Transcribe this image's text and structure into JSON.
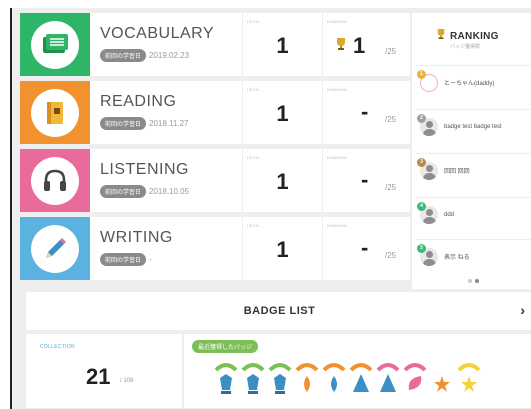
{
  "skills": [
    {
      "name": "VOCABULARY",
      "date_tag": "前回の学習日",
      "date": "2019.02.23",
      "level_label": "LEVEL",
      "level": "1",
      "ranking_label": "RANKING",
      "rank": "1",
      "rank_total": "/25",
      "color": "#2fb567"
    },
    {
      "name": "READING",
      "date_tag": "前回の学習日",
      "date": "2018.11.27",
      "level_label": "LEVEL",
      "level": "1",
      "ranking_label": "RANKING",
      "rank": "-",
      "rank_total": "/25",
      "color": "#f2922f"
    },
    {
      "name": "LISTENING",
      "date_tag": "前回の学習日",
      "date": "2018.10.05",
      "level_label": "LEVEL",
      "level": "1",
      "ranking_label": "RANKING",
      "rank": "-",
      "rank_total": "/25",
      "color": "#e96b9b"
    },
    {
      "name": "WRITING",
      "date_tag": "前回の学習日",
      "date": "-",
      "level_label": "LEVEL",
      "level": "1",
      "ranking_label": "RANKING",
      "rank": "-",
      "rank_total": "/25",
      "color": "#5bb1e0"
    }
  ],
  "ranking": {
    "title": "RANKING",
    "subtitle": "バッジ獲得数",
    "items": [
      {
        "num": "1",
        "name": "とーちゃん(daddy)",
        "num_color": "#e8b43a"
      },
      {
        "num": "2",
        "name": "badge test badge test",
        "num_color": "#a0a0a0"
      },
      {
        "num": "3",
        "name": "回回 回回",
        "num_color": "#b88a4a"
      },
      {
        "num": "4",
        "name": "ddd",
        "num_color": "#3cb878"
      },
      {
        "num": "5",
        "name": "表示 ねる",
        "num_color": "#3cb878"
      }
    ]
  },
  "badge_list": {
    "title": "BADGE LIST",
    "chevron": "›"
  },
  "collection": {
    "label": "COLLECTION",
    "count": "21",
    "total": "/ 108"
  },
  "recent": {
    "label": "最近獲得したバッジ"
  }
}
